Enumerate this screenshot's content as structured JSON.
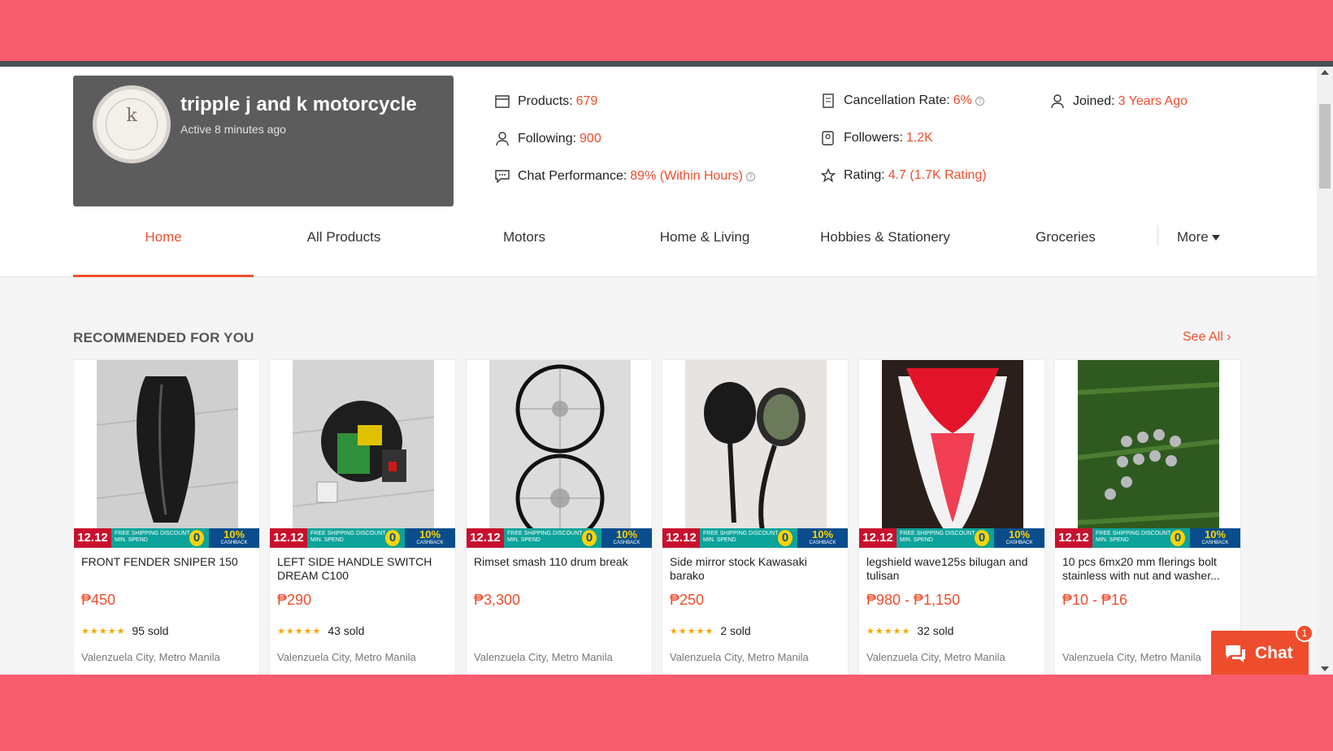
{
  "shop": {
    "name": "tripple j and k motorcycle",
    "active": "Active 8 minutes ago",
    "avatar_letter": "k"
  },
  "stats": {
    "products_label": "Products:",
    "products_value": "679",
    "following_label": "Following:",
    "following_value": "900",
    "chat_label": "Chat Performance:",
    "chat_value": "89% (Within Hours)",
    "cancel_label": "Cancellation Rate:",
    "cancel_value": "6%",
    "followers_label": "Followers:",
    "followers_value": "1.2K",
    "rating_label": "Rating:",
    "rating_value": "4.7 (1.7K Rating)",
    "joined_label": "Joined:",
    "joined_value": "3 Years Ago"
  },
  "tabs": [
    "Home",
    "All Products",
    "Motors",
    "Home & Living",
    "Hobbies & Stationery",
    "Groceries"
  ],
  "more_label": "More",
  "section_title": "RECOMMENDED FOR YOU",
  "see_all": "See All",
  "banner": {
    "sale": "12.12",
    "free_shipping": "FREE SHIPPING DISCOUNT",
    "min_spend": "MIN. SPEND",
    "zero": "0",
    "cashback_pct": "10%",
    "cashback": "CASHBACK"
  },
  "products": [
    {
      "name": "FRONT FENDER SNIPER 150",
      "price": "₱450",
      "sold": "95 sold",
      "location": "Valenzuela City, Metro Manila"
    },
    {
      "name": "LEFT SIDE HANDLE SWITCH DREAM C100",
      "price": "₱290",
      "sold": "43 sold",
      "location": "Valenzuela City, Metro Manila"
    },
    {
      "name": "Rimset smash 110 drum break",
      "price": "₱3,300",
      "sold": "",
      "location": "Valenzuela City, Metro Manila"
    },
    {
      "name": "Side mirror stock Kawasaki barako",
      "price": "₱250",
      "sold": "2 sold",
      "location": "Valenzuela City, Metro Manila"
    },
    {
      "name": "legshield wave125s bilugan and tulisan",
      "price": "₱980 - ₱1,150",
      "sold": "32 sold",
      "location": "Valenzuela City, Metro Manila"
    },
    {
      "name": "10 pcs 6mx20 mm flerings bolt stainless with nut and washer...",
      "price": "₱10 - ₱16",
      "sold": "",
      "location": "Valenzuela City, Metro Manila"
    }
  ],
  "stars": "★★★★★",
  "chat": {
    "label": "Chat",
    "badge": "1"
  },
  "colors": {
    "accent": "#ee4d2d",
    "frame": "#f85c6f",
    "card_dark": "#5c5c5c"
  }
}
